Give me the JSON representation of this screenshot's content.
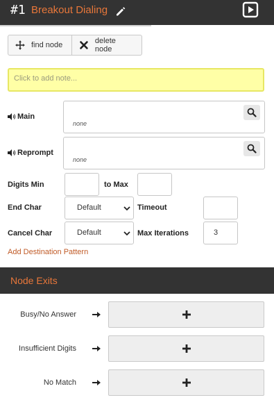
{
  "header": {
    "node_number": "#1",
    "node_title": "Breakout Dialing",
    "accent_color": "#e8773a",
    "bar_color": "#333333"
  },
  "toolbar": {
    "find_label": "find node",
    "delete_label": "delete node"
  },
  "note": {
    "placeholder": "Click to add note..."
  },
  "prompts": [
    {
      "label": "Main",
      "value": "none"
    },
    {
      "label": "Reprompt",
      "value": "none"
    }
  ],
  "digits": {
    "min_label": "Digits Min",
    "max_label": "to Max",
    "min_value": "",
    "max_value": ""
  },
  "end_char": {
    "label": "End Char",
    "selected": "Default"
  },
  "timeout": {
    "label": "Timeout",
    "value": ""
  },
  "cancel_char": {
    "label": "Cancel Char",
    "selected": "Default"
  },
  "max_iterations": {
    "label": "Max Iterations",
    "value": "3"
  },
  "add_destination_label": "Add Destination Pattern",
  "exits": {
    "title": "Node Exits",
    "items": [
      {
        "label": "Busy/No Answer"
      },
      {
        "label": "Insufficient Digits"
      },
      {
        "label": "No Match"
      }
    ]
  }
}
